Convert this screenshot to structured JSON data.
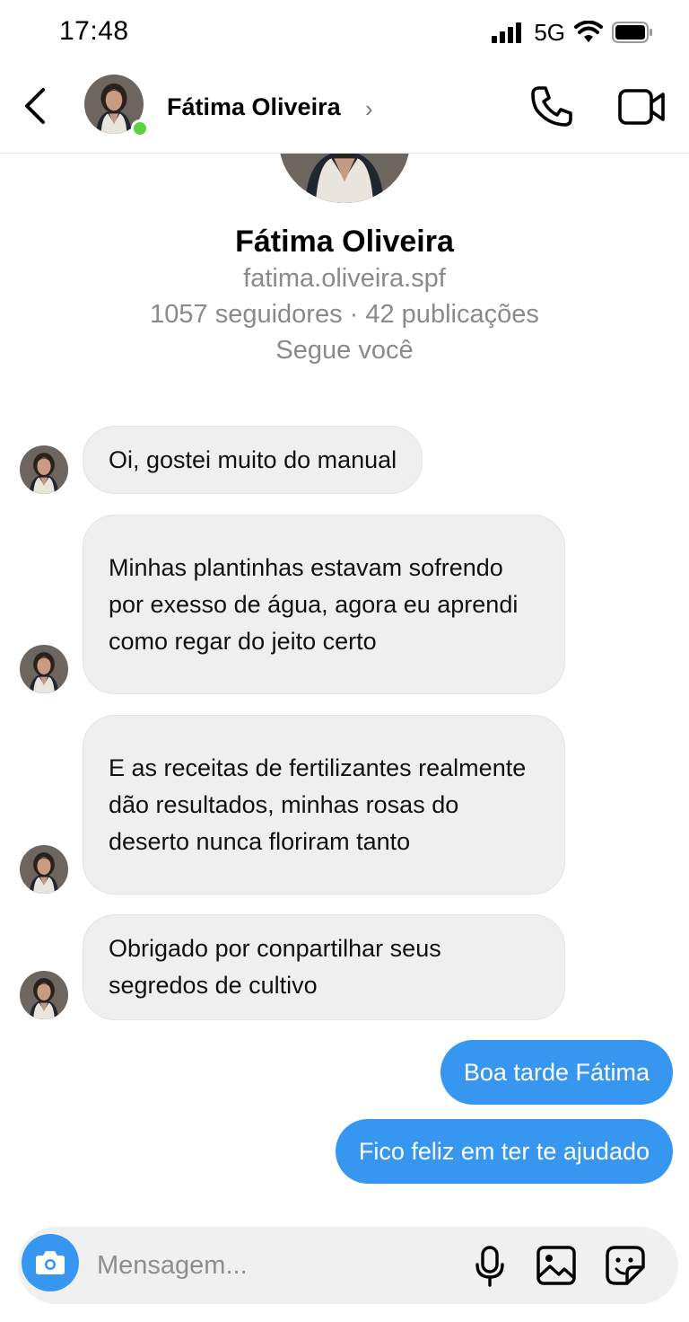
{
  "status_bar": {
    "time": "17:48",
    "network": "5G"
  },
  "header": {
    "name": "Fátima Oliveira",
    "chevron": "›"
  },
  "profile": {
    "name": "Fátima Oliveira",
    "handle": "fatima.oliveira.spf",
    "stats": "1057 seguidores · 42 publicações",
    "follows_you": "Segue você"
  },
  "messages": {
    "incoming": [
      "Oi, gostei muito do manual",
      "Minhas plantinhas estavam sofrendo por exesso de água, agora eu aprendi como regar do jeito certo",
      "E as receitas de fertilizantes realmente dão resultados, minhas rosas do deserto nunca floriram tanto",
      "Obrigado por conpartilhar seus segredos de cultivo"
    ],
    "outgoing": [
      "Boa tarde Fátima",
      "Fico feliz em ter te ajudado"
    ]
  },
  "composer": {
    "placeholder": "Mensagem..."
  },
  "colors": {
    "accent": "#3797f0",
    "incoming_bubble": "#efefef",
    "online": "#5ad33d"
  },
  "icons": [
    "back-icon",
    "phone-icon",
    "video-icon",
    "camera-icon",
    "mic-icon",
    "gallery-icon",
    "sticker-icon",
    "signal-icon",
    "wifi-icon",
    "battery-icon"
  ]
}
